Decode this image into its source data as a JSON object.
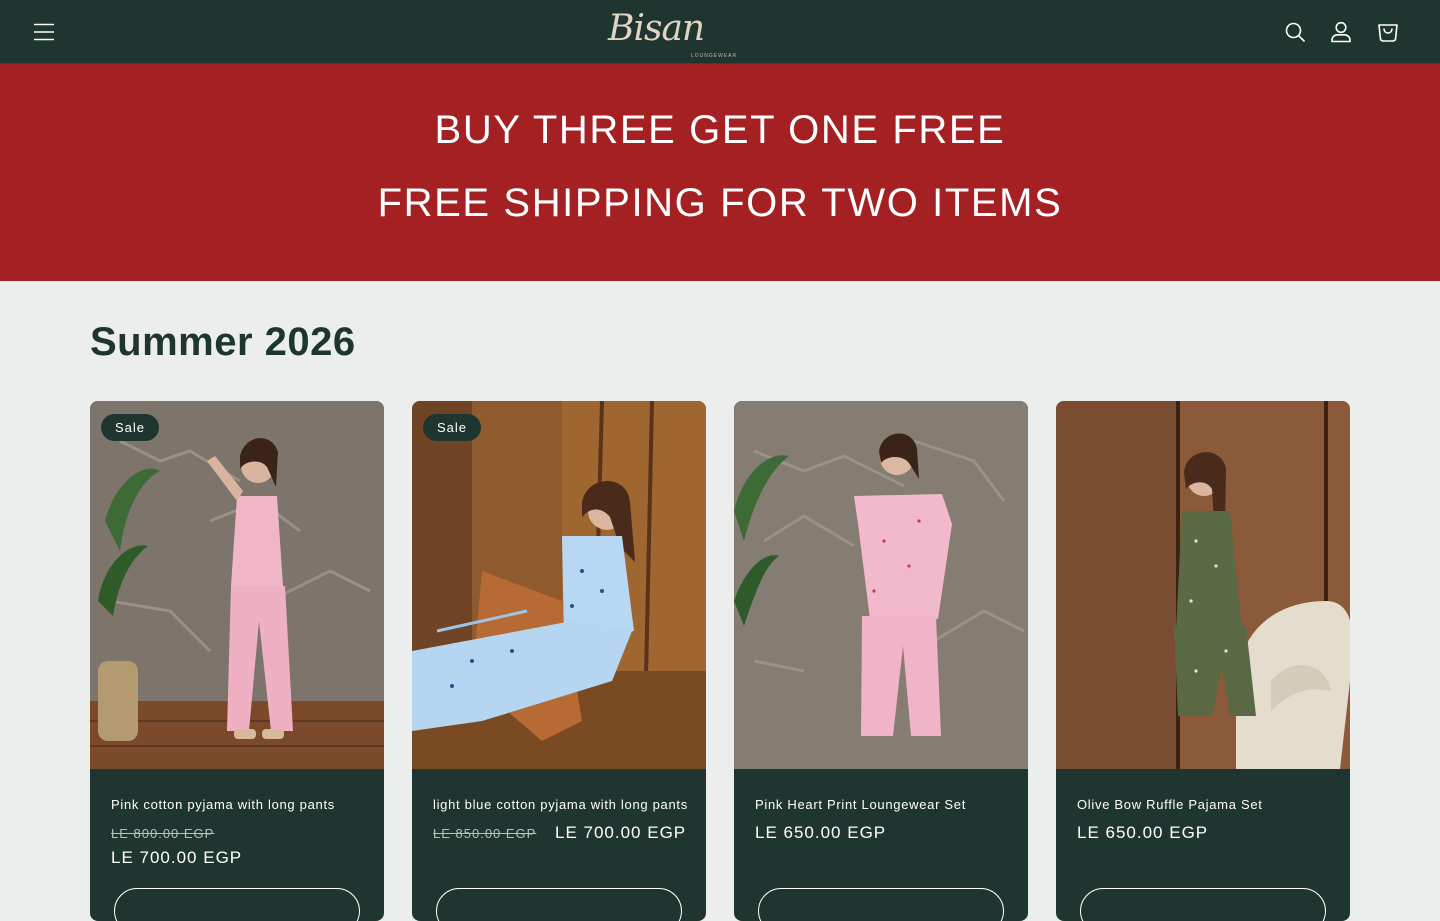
{
  "header": {
    "logo_text": "Bisan",
    "logo_subtext": "LOUNGEWEAR",
    "icons": [
      "menu-icon",
      "search-icon",
      "account-icon",
      "cart-icon"
    ]
  },
  "promo": {
    "line1": "BUY THREE GET ONE FREE",
    "line2": "FREE SHIPPING FOR TWO ITEMS"
  },
  "collection": {
    "title": "Summer 2026",
    "products": [
      {
        "title": "Pink cotton pyjama with long pants",
        "badge": "Sale",
        "price_old": "LE 800.00 EGP",
        "price": "LE 700.00 EGP"
      },
      {
        "title": "light blue cotton pyjama with long pants",
        "badge": "Sale",
        "price_old": "LE 850.00 EGP",
        "price": "LE 700.00 EGP"
      },
      {
        "title": "Pink Heart Print Loungewear Set",
        "price": "LE 650.00 EGP"
      },
      {
        "title": "Olive Bow Ruffle Pajama Set",
        "price": "LE 650.00 EGP"
      }
    ]
  },
  "colors": {
    "header_bg": "#1f352f",
    "promo_bg": "#a52023",
    "page_bg": "#ebeeed",
    "card_bg": "#1f352f"
  }
}
